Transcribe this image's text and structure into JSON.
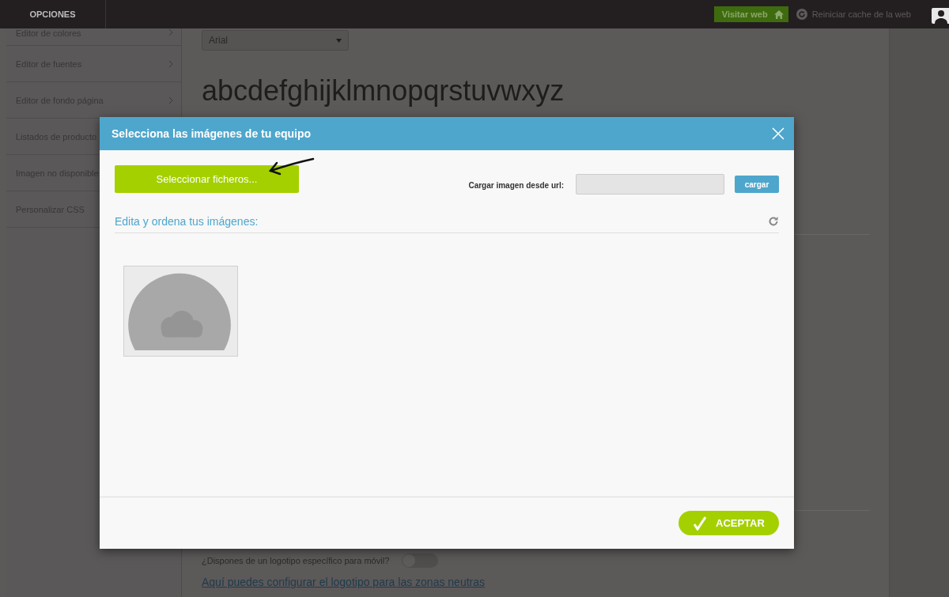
{
  "topbar": {
    "title": "OPCIONES",
    "visit_button": "Visitar web",
    "reset_link": "Reiniciar cache de la web"
  },
  "sidebar": {
    "items": [
      {
        "label": "Editor de colores"
      },
      {
        "label": "Editor de fuentes"
      },
      {
        "label": "Editor de fondo página"
      },
      {
        "label": "Listados de producto"
      },
      {
        "label": "Imagen no disponible"
      },
      {
        "label": "Personalizar CSS"
      }
    ]
  },
  "main": {
    "font_select": "Arial",
    "sample_text": "abcdefghijklmnopqrstuvwxyz",
    "mobile_logo_question": "¿Dispones de un logotipo específico para móvil?",
    "mobile_logo_toggle": {
      "on": false
    },
    "neutral_zone_link": "Aquí puedes configurar el logotipo para las zonas neutras"
  },
  "dialog": {
    "title": "Selecciona las imágenes de tu equipo",
    "select_files_button": "Seleccionar ficheros...",
    "url_label": "Cargar imagen desde url:",
    "load_button": "cargar",
    "section_title": "Edita y ordena tus imágenes:",
    "accept_button": "ACEPTAR"
  }
}
